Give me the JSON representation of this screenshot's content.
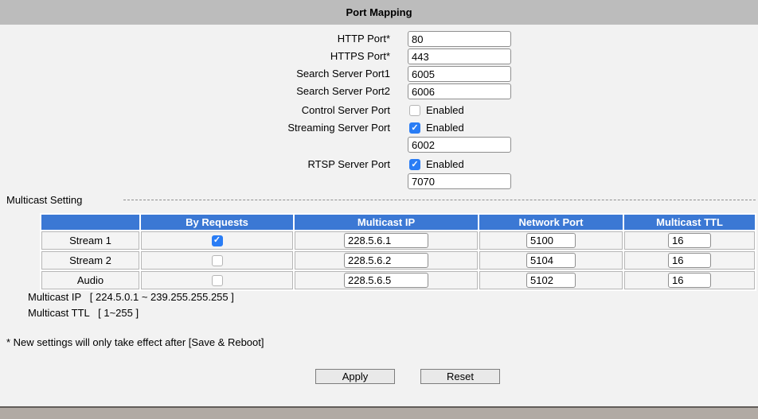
{
  "header": {
    "title": "Port Mapping"
  },
  "form": {
    "rows": [
      {
        "label": "HTTP Port*",
        "value": "80"
      },
      {
        "label": "HTTPS Port*",
        "value": "443"
      },
      {
        "label": "Search Server Port1",
        "value": "6005"
      },
      {
        "label": "Search Server Port2",
        "value": "6006"
      }
    ],
    "toggles": [
      {
        "label": "Control Server Port",
        "checkbox_label": "Enabled",
        "checked": false
      },
      {
        "label": "Streaming Server Port",
        "checkbox_label": "Enabled",
        "checked": true,
        "port": "6002"
      },
      {
        "label": "RTSP Server Port",
        "checkbox_label": "Enabled",
        "checked": true,
        "port": "7070"
      }
    ]
  },
  "multicast": {
    "section_label": "Multicast Setting",
    "table": {
      "headers": [
        "",
        "By Requests",
        "Multicast IP",
        "Network Port",
        "Multicast TTL"
      ],
      "rows": [
        {
          "name": "Stream 1",
          "by_requests": true,
          "ip": "228.5.6.1",
          "port": "5100",
          "ttl": "16"
        },
        {
          "name": "Stream 2",
          "by_requests": false,
          "ip": "228.5.6.2",
          "port": "5104",
          "ttl": "16"
        },
        {
          "name": "Audio",
          "by_requests": false,
          "ip": "228.5.6.5",
          "port": "5102",
          "ttl": "16"
        }
      ]
    },
    "notes": [
      "Multicast IP   [ 224.5.0.1 ~ 239.255.255.255 ]",
      "Multicast TTL   [ 1~255 ]"
    ]
  },
  "footer_note": "* New settings will only take effect after [Save & Reboot]",
  "buttons": {
    "apply": "Apply",
    "reset": "Reset"
  },
  "colors": {
    "page_bg": "#f2f2f2",
    "titlebar_bg": "#bcbcbc",
    "table_header_bg": "#3b78d4",
    "checkbox_checked": "#2a7df5",
    "footer_bg": "#b1aaa4"
  }
}
